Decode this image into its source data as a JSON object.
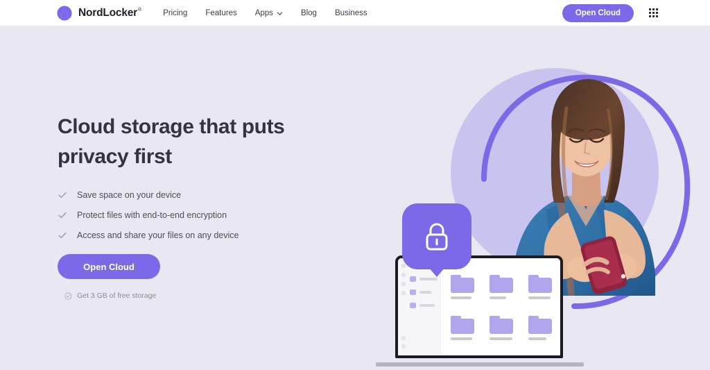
{
  "brand": {
    "name": "NordLocker",
    "registered_mark": "®",
    "logo_icon": "nordlocker-mountain-logo"
  },
  "header": {
    "nav_items": [
      {
        "label": "Pricing",
        "has_dropdown": false
      },
      {
        "label": "Features",
        "has_dropdown": false
      },
      {
        "label": "Apps",
        "has_dropdown": true,
        "dropdown_icon": "chevron-down-icon"
      },
      {
        "label": "Blog",
        "has_dropdown": false
      },
      {
        "label": "Business",
        "has_dropdown": false
      }
    ],
    "cta_label": "Open Cloud",
    "apps_grid_icon": "apps-grid-icon"
  },
  "hero": {
    "headline_line1": "Cloud storage that puts",
    "headline_line2": "privacy first",
    "bullets": [
      {
        "icon": "check-icon",
        "text": "Save space on your device"
      },
      {
        "icon": "check-icon",
        "text": "Protect files with end-to-end encryption"
      },
      {
        "icon": "check-icon",
        "text": "Access and share your files on any device"
      }
    ],
    "cta_label": "Open Cloud",
    "free_storage_icon": "check-circle-icon",
    "free_storage_note": "Get 3 GB of free storage"
  },
  "illustration": {
    "lock_badge_icon": "padlock-icon",
    "blob_icon": "circle-blob",
    "ring_icon": "purple-arc-ring",
    "photo_icon": "woman-with-phone-photo",
    "laptop_icon": "laptop-mockup",
    "folder_icon": "folder-icon",
    "folder_count": 6
  },
  "colors": {
    "page_background": "#e9e8f2",
    "header_background": "#ffffff",
    "accent_purple": "#7b69e8",
    "blob_purple": "#c9c3ef",
    "folder_purple": "#b1a6ee",
    "heading_text": "#33343f",
    "body_text": "#4c4d59",
    "muted_text": "#8a8b99"
  }
}
